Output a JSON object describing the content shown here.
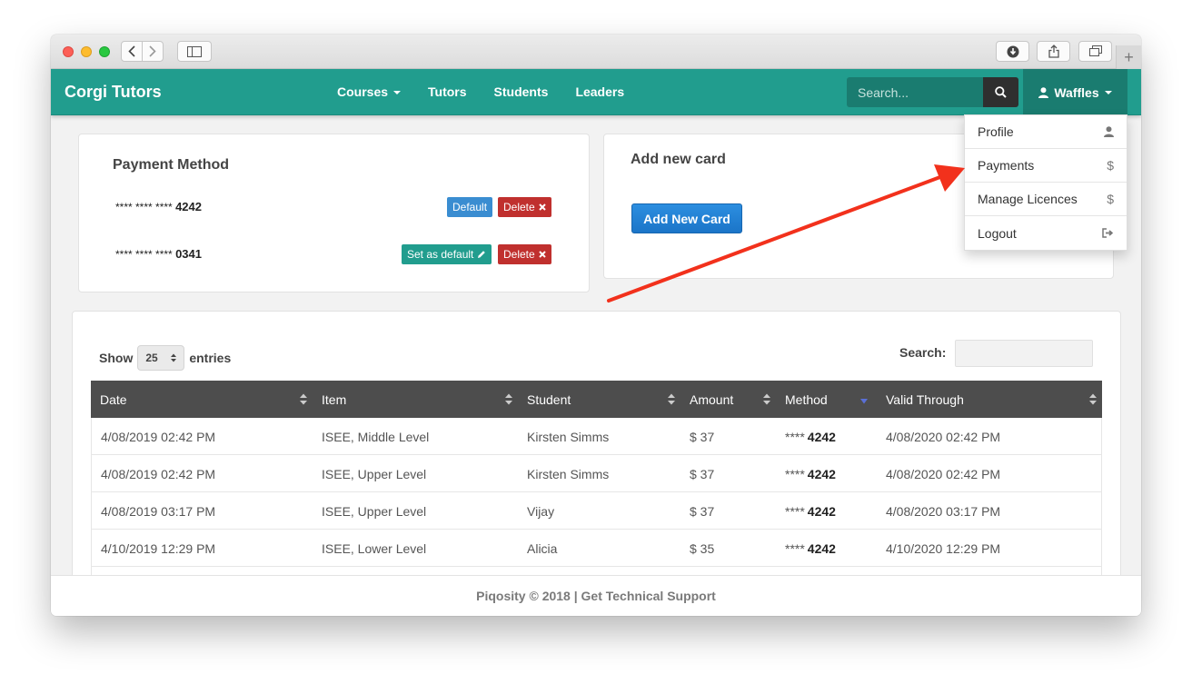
{
  "app": {
    "brand": "Corgi Tutors",
    "accent": "#219d8e"
  },
  "nav": {
    "courses": "Courses",
    "tutors": "Tutors",
    "students": "Students",
    "leaders": "Leaders",
    "search_placeholder": "Search...",
    "user": "Waffles"
  },
  "dropdown": [
    {
      "label": "Profile",
      "icon": "user-icon"
    },
    {
      "label": "Payments",
      "icon": "$"
    },
    {
      "label": "Manage Licences",
      "icon": "$"
    },
    {
      "label": "Logout",
      "icon": "sign-out-icon"
    }
  ],
  "payment_method": {
    "title": "Payment Method",
    "cards": [
      {
        "mask": "**** **** ****",
        "last4": "4242",
        "default_label": "Default",
        "delete_label": "Delete"
      },
      {
        "mask": "**** **** ****",
        "last4": "0341",
        "set_default_label": "Set as default",
        "delete_label": "Delete"
      }
    ]
  },
  "add_card": {
    "title": "Add new card",
    "button": "Add New Card"
  },
  "table": {
    "show": "Show",
    "entries_value": "25",
    "entries": "entries",
    "search_label": "Search:",
    "columns": [
      "Date",
      "Item",
      "Student",
      "Amount",
      "Method",
      "Valid Through"
    ],
    "rows": [
      {
        "date": "4/08/2019 02:42 PM",
        "item": "ISEE, Middle Level",
        "student": "Kirsten Simms",
        "amount": "$ 37",
        "mask": "****",
        "last4": "4242",
        "valid": "4/08/2020 02:42 PM"
      },
      {
        "date": "4/08/2019 02:42 PM",
        "item": "ISEE, Upper Level",
        "student": "Kirsten Simms",
        "amount": "$ 37",
        "mask": "****",
        "last4": "4242",
        "valid": "4/08/2020 02:42 PM"
      },
      {
        "date": "4/08/2019 03:17 PM",
        "item": "ISEE, Upper Level",
        "student": "Vijay",
        "amount": "$ 37",
        "mask": "****",
        "last4": "4242",
        "valid": "4/08/2020 03:17 PM"
      },
      {
        "date": "4/10/2019 12:29 PM",
        "item": "ISEE, Lower Level",
        "student": "Alicia",
        "amount": "$ 35",
        "mask": "****",
        "last4": "4242",
        "valid": "4/10/2020 12:29 PM"
      }
    ]
  },
  "footer": "Piqosity © 2018 | Get Technical Support"
}
